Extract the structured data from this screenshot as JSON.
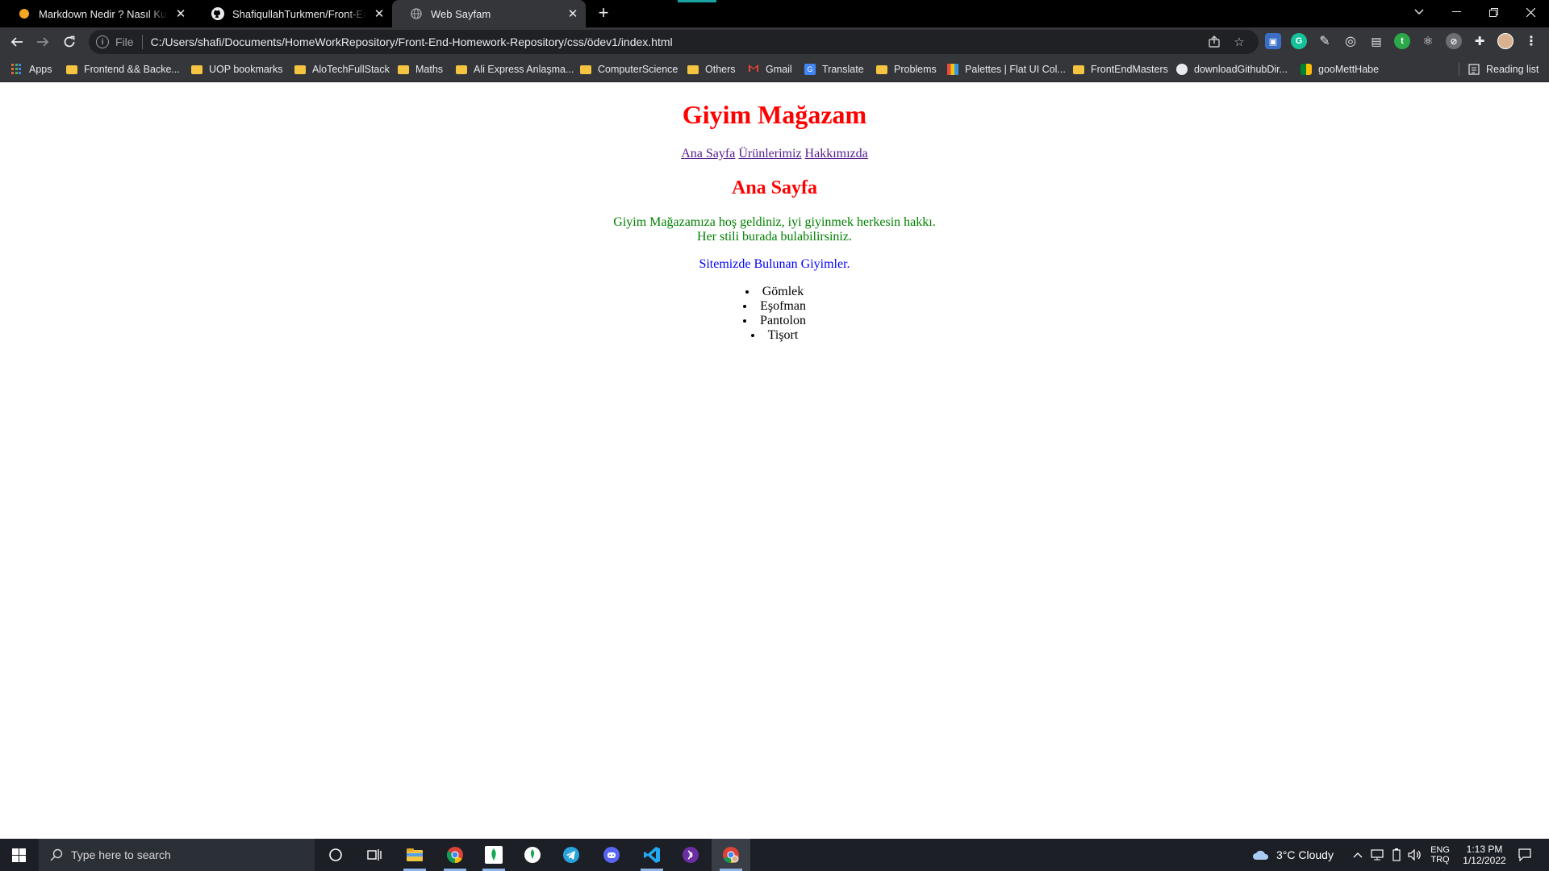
{
  "browser": {
    "tabs": [
      {
        "title": "Markdown Nedir ? Nasıl Kullanılır",
        "icon": "orange-circle-favicon",
        "close": "✕"
      },
      {
        "title": "ShafiqullahTurkmen/Front-End-H",
        "icon": "github-favicon",
        "close": "✕"
      },
      {
        "title": "Web Sayfam",
        "icon": "globe-favicon",
        "close": "✕",
        "active": true
      }
    ],
    "address": {
      "scheme": "File",
      "url": "C:/Users/shafi/Documents/HomeWorkRepository/Front-End-Homework-Repository/css/ödev1/index.html"
    },
    "bookmarks": [
      {
        "label": "Apps",
        "icon": "apps-grid-icon"
      },
      {
        "label": "Frontend && Backe...",
        "icon": "folder-icon"
      },
      {
        "label": "UOP bookmarks",
        "icon": "folder-icon"
      },
      {
        "label": "AloTechFullStack",
        "icon": "folder-icon"
      },
      {
        "label": "Maths",
        "icon": "folder-icon"
      },
      {
        "label": "Ali Express Anlaşma...",
        "icon": "folder-icon"
      },
      {
        "label": "ComputerScience",
        "icon": "folder-icon"
      },
      {
        "label": "Others",
        "icon": "folder-icon"
      },
      {
        "label": "Gmail",
        "icon": "gmail-icon"
      },
      {
        "label": "Translate",
        "icon": "translate-icon"
      },
      {
        "label": "Problems",
        "icon": "folder-icon"
      },
      {
        "label": "Palettes | Flat UI Col...",
        "icon": "palette-icon"
      },
      {
        "label": "FrontEndMasters",
        "icon": "folder-icon"
      },
      {
        "label": "downloadGithubDir...",
        "icon": "globe-icon"
      },
      {
        "label": "gooMettHabe",
        "icon": "meet-icon"
      }
    ],
    "reading_list": "Reading list"
  },
  "page": {
    "heading": "Giyim Mağazam",
    "nav": [
      "Ana Sayfa",
      "Ürünlerimiz",
      "Hakkımızda"
    ],
    "subheading": "Ana Sayfa",
    "welcome_line1": "Giyim Mağazamıza hoş geldiniz, iyi giyinmek herkesin hakkı.",
    "welcome_line2": "Her stili burada bulabilirsiniz.",
    "products_title": "Sitemizde Bulunan Giyimler.",
    "products": [
      "Gömlek",
      "Eşofman",
      "Pantolon",
      "Tişort"
    ],
    "colors": {
      "heading": "#ff0000",
      "welcome": "#008000",
      "products_title": "#0000ff",
      "link": "#551a8b"
    }
  },
  "taskbar": {
    "search_placeholder": "Type here to search",
    "weather": "3°C  Cloudy",
    "lang_top": "ENG",
    "lang_bottom": "TRQ",
    "time": "1:13 PM",
    "date": "1/12/2022"
  }
}
